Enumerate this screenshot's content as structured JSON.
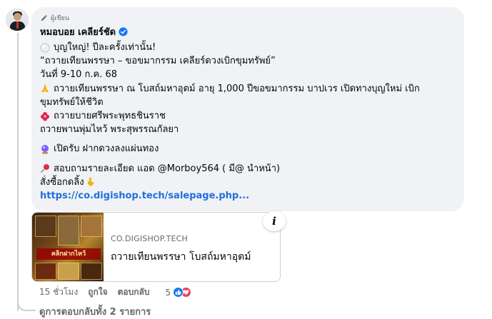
{
  "comment": {
    "author_badge": "ผู้เขียน",
    "author_name": "หมอบอย เคลียร์ชัด",
    "lines": [
      "บุญใหญ่! ปีละครั้งเท่านั้น!",
      "“ถวายเทียนพรรษา – ขอขมากรรม เคลียร์ดวงเบิกขุมทรัพย์”",
      "วันที่ 9-10 ก.ค. 68",
      "ถวายเทียนพรรษา ณ โบสถ์มหาอุตม์ อายุ 1,000 ปีขอขมากรรม บาปเวร เปิดทางบุญใหม่ เบิกขุมทรัพย์ให้ชีวิต",
      "ถวายบายศรีพระพุทธชินราช",
      "ถวายพานพุ่มไหว้ พระสุพรรณกัลยา",
      "เปิดรับ ฝากดวงลงแผ่นทอง",
      "สอบถามรายละเอียด แอด @Morboy564 ( มี@ นำหน้า)",
      "สั่งซื้อกดลิ้ง"
    ],
    "link": "https://co.digishop.tech/salepage.php..."
  },
  "preview": {
    "domain": "CO.DIGISHOP.TECH",
    "title": "ถวายเทียนพรรษา โบสถ์มหาอุตม์",
    "thumb_text": "คลิกฝากไหว้",
    "info_label": "i"
  },
  "actions": {
    "time": "15 ชั่วโมง",
    "like": "ถูกใจ",
    "reply": "ตอบกลับ",
    "reaction_count": "5"
  },
  "replies_link": "ดูการตอบกลับทั้ง 2 รายการ",
  "colors": {
    "link": "#216fdb",
    "bubble": "#f0f2f5",
    "meta": "#65676b",
    "like": "#1877f2",
    "love": "#f33e58"
  },
  "icons": [
    "pen-icon",
    "verified-icon",
    "pearl-icon",
    "praying-hands-icon",
    "hibiscus-icon",
    "crystal-ball-icon",
    "pushpin-icon",
    "pointing-down-icon",
    "info-icon",
    "like-reaction-icon",
    "love-reaction-icon"
  ]
}
